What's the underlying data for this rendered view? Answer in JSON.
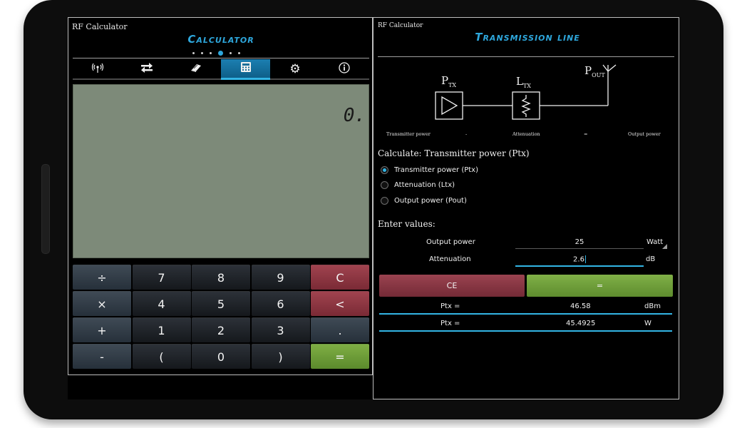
{
  "left_panel": {
    "app_name": "RF Calculator",
    "title": "Calculator",
    "tabs": [
      {
        "icon": "antenna-icon",
        "glyph": "((•))",
        "active": false
      },
      {
        "icon": "swap-arrows-icon",
        "glyph": "⇄",
        "active": false
      },
      {
        "icon": "book-icon",
        "glyph": "📖",
        "active": false
      },
      {
        "icon": "calculator-icon",
        "glyph": "▦",
        "active": true
      },
      {
        "icon": "gear-icon",
        "glyph": "⚙",
        "active": false
      },
      {
        "icon": "info-icon",
        "glyph": "ⓘ",
        "active": false
      }
    ],
    "display_value": "0.",
    "keys": [
      [
        "÷",
        "7",
        "8",
        "9",
        "C"
      ],
      [
        "×",
        "4",
        "5",
        "6",
        "<"
      ],
      [
        "+",
        "1",
        "2",
        "3",
        "."
      ],
      [
        "-",
        "(",
        "0",
        ")",
        "="
      ]
    ]
  },
  "right_panel": {
    "app_name": "RF Calculator",
    "title": "Transmission line",
    "diagram": {
      "ptx_label": "P",
      "ptx_sub": "TX",
      "ltx_label": "L",
      "ltx_sub": "TX",
      "pout_label": "P",
      "pout_sub": "OUT",
      "captions": [
        "Transmitter power",
        "-",
        "Attenuation",
        "=",
        "Output power"
      ]
    },
    "calculate_label": "Calculate: Transmitter power (Ptx)",
    "options": [
      {
        "label": "Transmitter power (Ptx)",
        "selected": true
      },
      {
        "label": "Attenuation (Ltx)",
        "selected": false
      },
      {
        "label": "Output power (Pout)",
        "selected": false
      }
    ],
    "enter_values_label": "Enter values:",
    "inputs": [
      {
        "label": "Output power",
        "value": "25",
        "unit": "Watt"
      },
      {
        "label": "Attenuation",
        "value": "2.6",
        "unit": "dB"
      }
    ],
    "ce_label": "CE",
    "equals_label": "=",
    "results": [
      {
        "label": "Ptx =",
        "value": "46.58",
        "unit": "dBm"
      },
      {
        "label": "Ptx =",
        "value": "45.4925",
        "unit": "W"
      }
    ]
  },
  "colors": {
    "accent": "#33b5e5",
    "lcd_background": "#7d8a79",
    "clear_button": "#8b3541",
    "equals_button": "#6e9e38"
  }
}
